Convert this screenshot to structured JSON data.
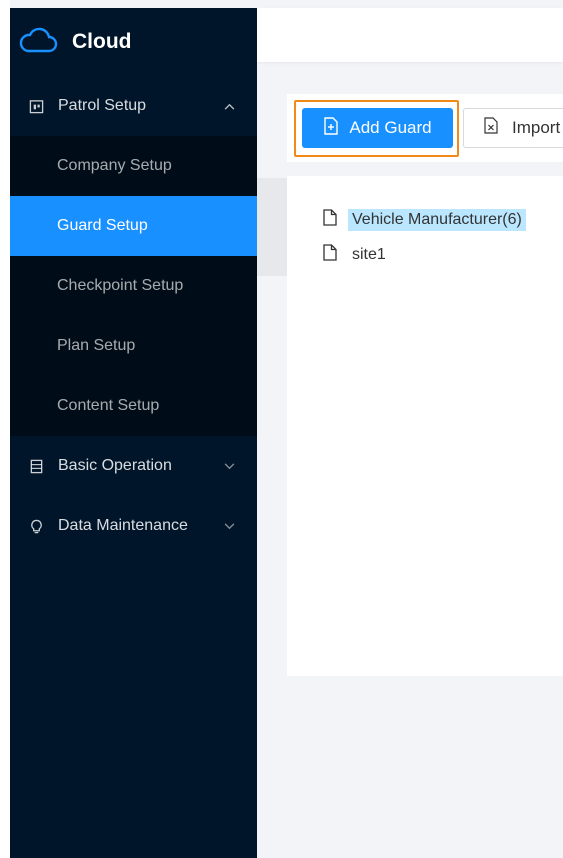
{
  "app": {
    "title": "Cloud"
  },
  "sidebar": {
    "groups": [
      {
        "label": "Patrol Setup",
        "icon": "calendar-icon",
        "expanded": true,
        "items": [
          {
            "label": "Company Setup"
          },
          {
            "label": "Guard Setup",
            "active": true
          },
          {
            "label": "Checkpoint Setup"
          },
          {
            "label": "Plan Setup"
          },
          {
            "label": "Content Setup"
          }
        ]
      },
      {
        "label": "Basic Operation",
        "icon": "database-icon",
        "expanded": false
      },
      {
        "label": "Data Maintenance",
        "icon": "bulb-icon",
        "expanded": false
      }
    ]
  },
  "toolbar": {
    "add_label": "Add Guard",
    "import_label": "Import"
  },
  "tree": {
    "nodes": [
      {
        "label": "Vehicle Manufacturer(6)",
        "selected": true
      },
      {
        "label": "site1",
        "selected": false
      }
    ]
  },
  "colors": {
    "sidebar_bg": "#001529",
    "submenu_bg": "#000c17",
    "accent": "#1890ff",
    "highlight": "#f28a1a",
    "selected_node": "#bae7ff"
  }
}
